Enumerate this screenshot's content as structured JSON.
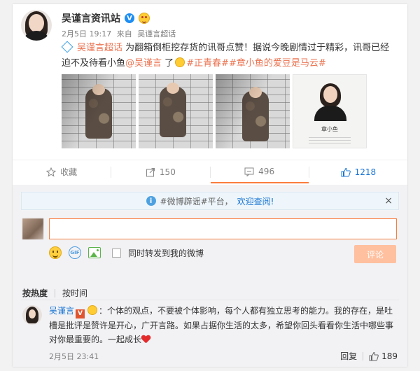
{
  "post": {
    "author": "吴谨言资讯站",
    "verified_mark": "V",
    "date": "2月5日 19:17",
    "source_prefix": "来自",
    "source": "吴谨言超话",
    "super_topic": "吴谨言超话",
    "text_1": "为翻箱倒柜挖存货的讯哥点赞！据说今晚剧情过于精彩，讯哥已经迫不及待看小鱼",
    "mention": "@吴谨言",
    "text_2": "了",
    "topic_1": "#正青春#",
    "topic_2": "#章小鱼的爱豆是马云#",
    "id_card_name": "章小鱼"
  },
  "actions": {
    "favorite_label": "收藏",
    "share_count": "150",
    "comment_count": "496",
    "like_count": "1218"
  },
  "comment_box": {
    "notice_prefix": "#微博辟谣#平台，",
    "notice_link": "欢迎查阅!",
    "close_symbol": "×",
    "input_value": "",
    "gif_label": "GIF",
    "repost_label": "同时转发到我的微博",
    "submit_label": "评论"
  },
  "sort": {
    "hot_label": "按热度",
    "time_label": "按时间"
  },
  "comment": {
    "author": "吴谨言",
    "verified_mark": "V",
    "text": "：个体的观点，不要被个体影响，每个人都有独立思考的能力。我的存在，是吐槽是批评是赞许是开心，广开言路。如果占据你生活的太多，希望你回头看看你生活中哪些事对你最重要的。一起成长",
    "date": "2月5日 23:41",
    "reply_label": "回复",
    "like_count": "189"
  }
}
